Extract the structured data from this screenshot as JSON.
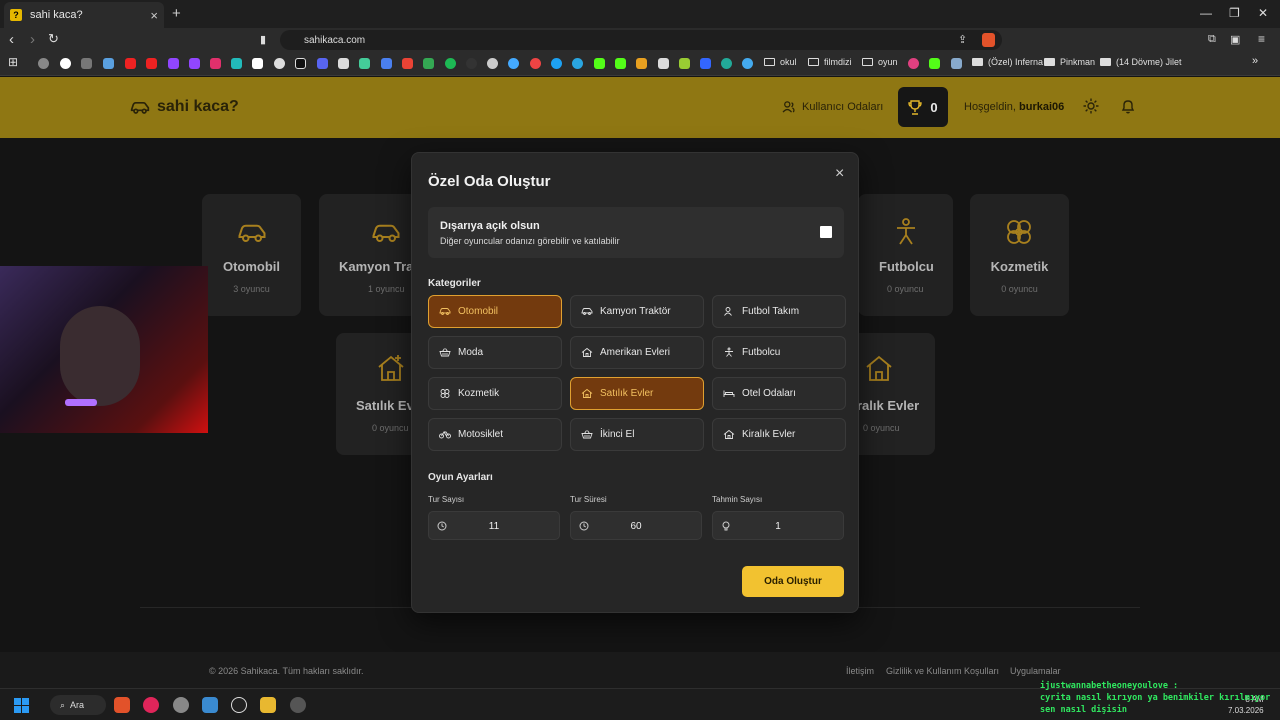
{
  "browser": {
    "tab_title": "sahi kaca?",
    "tab_favicon": "?",
    "url": "sahikaca.com",
    "bookmarks": [
      {
        "label": "okul",
        "type": "folder"
      },
      {
        "label": "filmdizi",
        "type": "folder"
      },
      {
        "label": "oyun",
        "type": "folder"
      },
      {
        "label": "(Özel) Inferna",
        "type": "page"
      },
      {
        "label": "Pinkman",
        "type": "page"
      },
      {
        "label": "(14 Dövme) Jilet",
        "type": "page"
      }
    ],
    "bookmark_more": "»"
  },
  "header": {
    "logo_text": "sahi kaca?",
    "rooms_link": "Kullanıcı Odaları",
    "trophy_count": "0",
    "welcome_prefix": "Hoşgeldin,",
    "username": "burkai06",
    "accent_color": "#8f7713"
  },
  "background_cards": [
    {
      "title": "Otomobil",
      "count": "3 oyuncu",
      "icon": "car-icon"
    },
    {
      "title": "Kamyon Tra",
      "count": "1 oyuncu",
      "icon": "truck-icon"
    },
    {
      "title": "Futbolcu",
      "count": "0 oyuncu",
      "icon": "person-icon"
    },
    {
      "title": "Kozmetik",
      "count": "0 oyuncu",
      "icon": "flower-icon"
    },
    {
      "title": "Satılık Ev",
      "count": "0 oyuncu",
      "icon": "house-plus-icon"
    },
    {
      "title": "ralık Evler",
      "count": "0 oyuncu",
      "icon": "house-icon"
    }
  ],
  "modal": {
    "title": "Özel Oda Oluştur",
    "close_label": "×",
    "public": {
      "title": "Dışarıya açık olsun",
      "description": "Diğer oyuncular odanızı görebilir ve katılabilir",
      "checked": false
    },
    "categories_label": "Kategoriler",
    "categories": [
      {
        "label": "Otomobil",
        "icon": "car-icon",
        "selected": true
      },
      {
        "label": "Kamyon Traktör",
        "icon": "truck-icon",
        "selected": false
      },
      {
        "label": "Futbol Takım",
        "icon": "users-icon",
        "selected": false
      },
      {
        "label": "Moda",
        "icon": "basket-icon",
        "selected": false
      },
      {
        "label": "Amerikan Evleri",
        "icon": "house-icon",
        "selected": false
      },
      {
        "label": "Futbolcu",
        "icon": "person-icon",
        "selected": false
      },
      {
        "label": "Kozmetik",
        "icon": "flower-icon",
        "selected": false
      },
      {
        "label": "Satılık Evler",
        "icon": "house-icon",
        "selected": true
      },
      {
        "label": "Otel Odaları",
        "icon": "bed-icon",
        "selected": false
      },
      {
        "label": "Motosiklet",
        "icon": "bike-icon",
        "selected": false
      },
      {
        "label": "İkinci El",
        "icon": "basket-icon",
        "selected": false
      },
      {
        "label": "Kiralık Evler",
        "icon": "house-icon",
        "selected": false
      }
    ],
    "settings_label": "Oyun Ayarları",
    "settings": [
      {
        "label": "Tur Sayısı",
        "value": "11",
        "icon": "clock-icon"
      },
      {
        "label": "Tur Süresi",
        "value": "60",
        "icon": "clock-icon"
      },
      {
        "label": "Tahmin Sayısı",
        "value": "1",
        "icon": "bulb-icon"
      }
    ],
    "create_button": "Oda Oluştur",
    "create_color": "#f2c230"
  },
  "footer": {
    "copyright": "© 2026 Sahikaca. Tüm hakları saklıdır.",
    "links": [
      "İletişim",
      "Gizlilik ve Kullanım Koşulları",
      "Uygulamalar"
    ]
  },
  "chat": {
    "username": "ijustwannabetheoneyoulove :",
    "message": "cyrita nasıl kırıyon ya benimkiler kırılmıyor sen nasıl dişisin"
  },
  "taskbar": {
    "search_label": "Ara",
    "time": "8 AM",
    "date": "7.03.2026"
  }
}
